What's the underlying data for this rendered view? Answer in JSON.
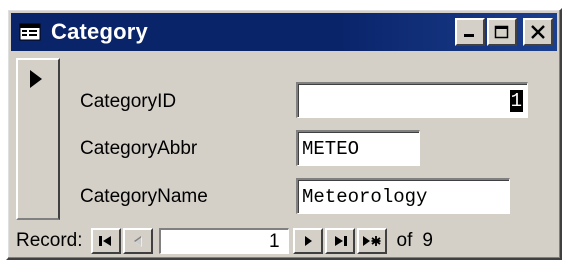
{
  "window": {
    "title": "Category",
    "icon": "form-icon"
  },
  "controls": {
    "minimize": "minimize-icon",
    "maximize": "maximize-icon",
    "close": "close-icon"
  },
  "fields": [
    {
      "label": "CategoryID",
      "value": "1"
    },
    {
      "label": "CategoryAbbr",
      "value": "METEO"
    },
    {
      "label": "CategoryName",
      "value": "Meteorology"
    }
  ],
  "navigation": {
    "record_label": "Record:",
    "current": "1",
    "of_label": "of",
    "total": "9"
  }
}
